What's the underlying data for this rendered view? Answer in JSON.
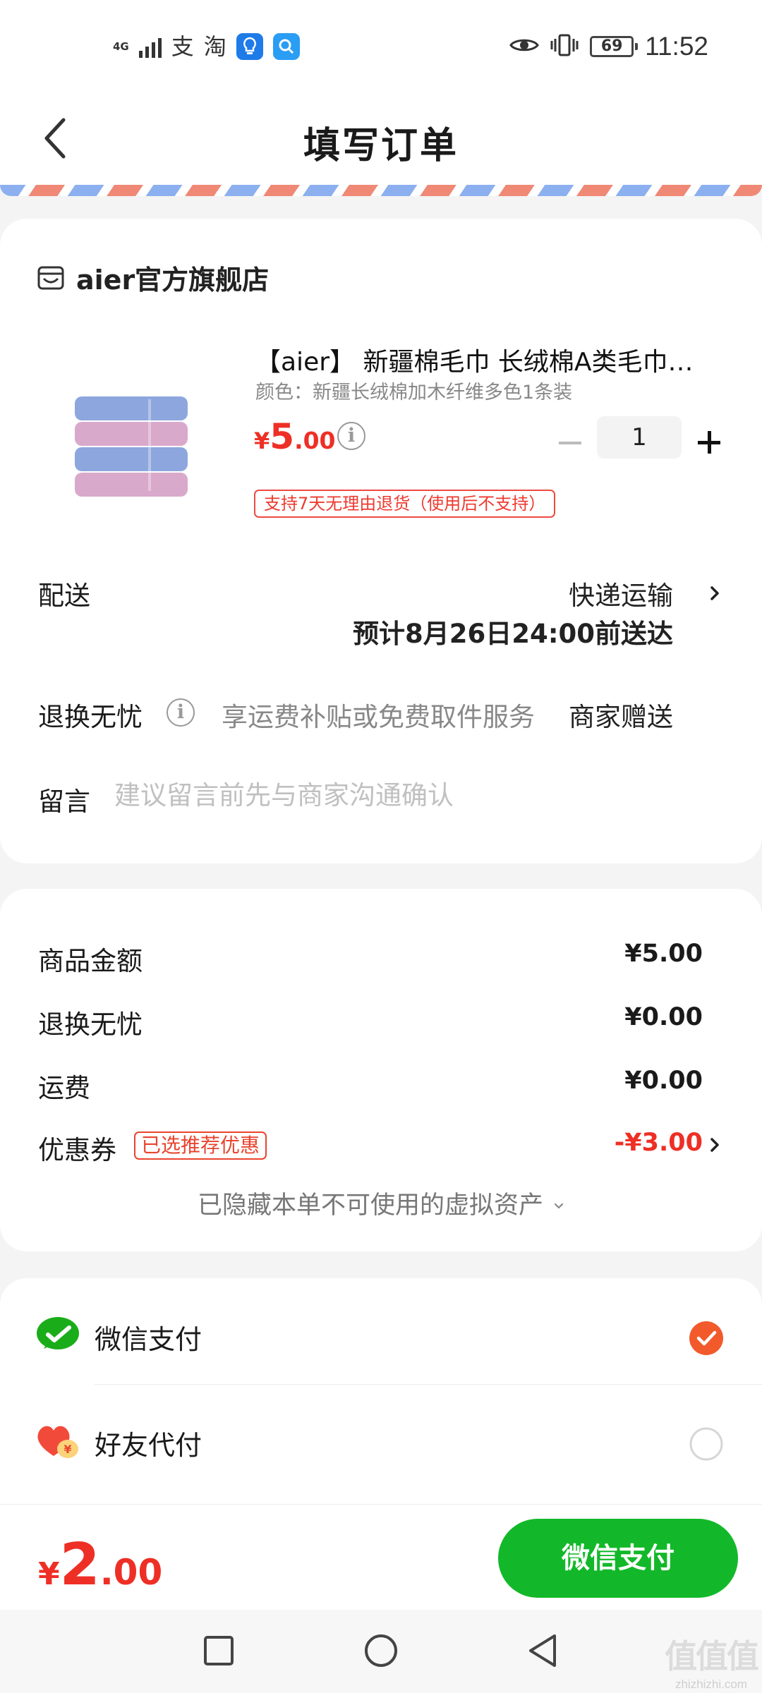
{
  "status_bar": {
    "network": "4G",
    "app_alipay": "支",
    "app_taobao": "淘",
    "battery": "69",
    "time": "11:52"
  },
  "header": {
    "title": "填写订单"
  },
  "store": {
    "name": "aier官方旗舰店",
    "icon": "store-icon"
  },
  "product": {
    "title": "【aier】 新疆棉毛巾 长绒棉A类毛巾…",
    "spec": "颜色：新疆长绒棉加木纤维多色1条装",
    "price": {
      "currency": "¥",
      "integer": "5",
      "decimal": ".00"
    },
    "quantity": "1",
    "return_tag": "支持7天无理由退货（使用后不支持）"
  },
  "delivery": {
    "label": "配送",
    "method": "快递运输",
    "eta": "预计8月26日24:00前送达"
  },
  "return_free": {
    "label": "退换无忧",
    "description": "享运费补贴或免费取件服务",
    "value": "商家赠送"
  },
  "message": {
    "label": "留言",
    "placeholder": "建议留言前先与商家沟通确认"
  },
  "summary": {
    "items": [
      {
        "label": "商品金额",
        "value": "¥5.00"
      },
      {
        "label": "退换无忧",
        "value": "¥0.00"
      },
      {
        "label": "运费",
        "value": "¥0.00"
      }
    ],
    "coupon": {
      "label": "优惠券",
      "tag": "已选推荐优惠",
      "value": "-¥3.00"
    },
    "hidden_assets": "已隐藏本单不可使用的虚拟资产"
  },
  "payment": {
    "options": [
      {
        "label": "微信支付",
        "icon": "wechat-pay-icon",
        "selected": true
      },
      {
        "label": "好友代付",
        "icon": "friend-pay-icon",
        "selected": false
      }
    ]
  },
  "footer": {
    "total": {
      "currency": "¥",
      "integer": "2",
      "decimal": ".00"
    },
    "pay_button": "微信支付"
  },
  "watermark": {
    "logo": "值值值",
    "url": "zhizhizhi.com"
  },
  "colors": {
    "price_red": "#ee2f25",
    "pay_green": "#12b829",
    "selected_radio": "#f25a2c"
  }
}
